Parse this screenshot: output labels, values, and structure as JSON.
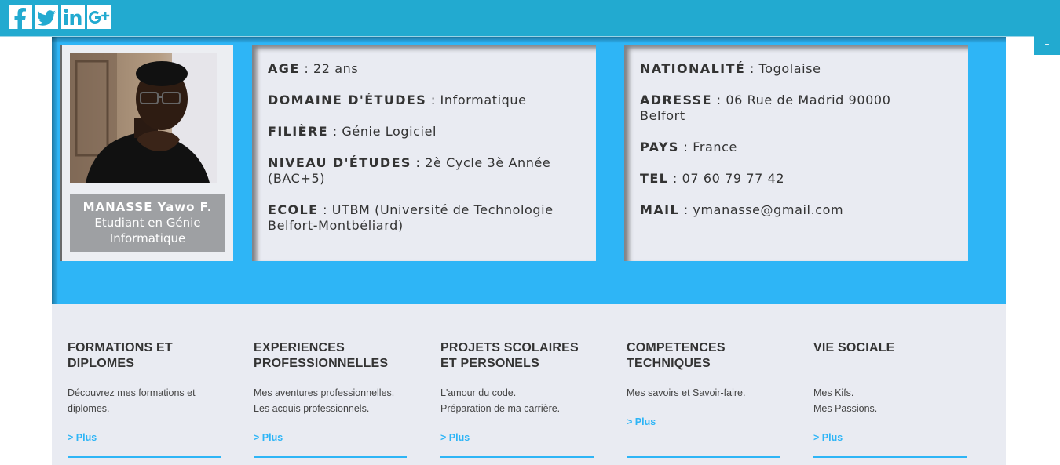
{
  "social": [
    {
      "icon": "facebook-icon",
      "glyph": "f"
    },
    {
      "icon": "twitter-icon",
      "glyph": "t"
    },
    {
      "icon": "linkedin-icon",
      "glyph": "in"
    },
    {
      "icon": "google-plus-icon",
      "glyph": "g+"
    }
  ],
  "header": {
    "collapse_label": "–"
  },
  "profile": {
    "name": "MANASSE Yawo F.",
    "role": "Etudiant en Génie Informatique"
  },
  "info_left": [
    {
      "label": "AGE",
      "value": " : 22 ans"
    },
    {
      "label": "DOMAINE D'ÉTUDES",
      "value": " : Informatique"
    },
    {
      "label": "FILIÈRE",
      "value": " : Génie Logiciel"
    },
    {
      "label": "NIVEAU D'ÉTUDES",
      "value": " : 2è Cycle 3è Année (BAC+5)"
    },
    {
      "label": "ECOLE",
      "value": " : UTBM (Université de Technologie Belfort-Montbéliard)"
    }
  ],
  "info_right": [
    {
      "label": "NATIONALITÉ",
      "value": " : Togolaise"
    },
    {
      "label": "ADRESSE",
      "value": " : 06 Rue de Madrid 90000 Belfort"
    },
    {
      "label": "PAYS",
      "value": " : France"
    },
    {
      "label": "TEL",
      "value": " : 07 60 79 77 42"
    },
    {
      "label": "MAIL",
      "value": " : ymanasse@gmail.com"
    }
  ],
  "sections": [
    {
      "title": "FORMATIONS ET DIPLOMES",
      "lines": [
        "Découvrez mes formations et",
        "diplomes."
      ],
      "more": "> Plus"
    },
    {
      "title": "EXPERIENCES PROFESSIONNELLES",
      "lines": [
        "Mes aventures professionnelles.",
        "Les acquis professionnels."
      ],
      "more": "> Plus"
    },
    {
      "title": "PROJETS SCOLAIRES ET PERSONELS",
      "lines": [
        "L'amour du code.",
        "Préparation de ma carrière."
      ],
      "more": "> Plus"
    },
    {
      "title": "COMPETENCES TECHNIQUES",
      "lines": [
        "Mes savoirs et Savoir-faire."
      ],
      "more": "> Plus"
    },
    {
      "title": "VIE SOCIALE",
      "lines": [
        "Mes Kifs.",
        "Mes Passions."
      ],
      "more": "> Plus"
    }
  ],
  "colors": {
    "topbar": "#22aad0",
    "band": "#2eb5f6",
    "card": "#e9ebf2",
    "link": "#2eb5f6"
  }
}
